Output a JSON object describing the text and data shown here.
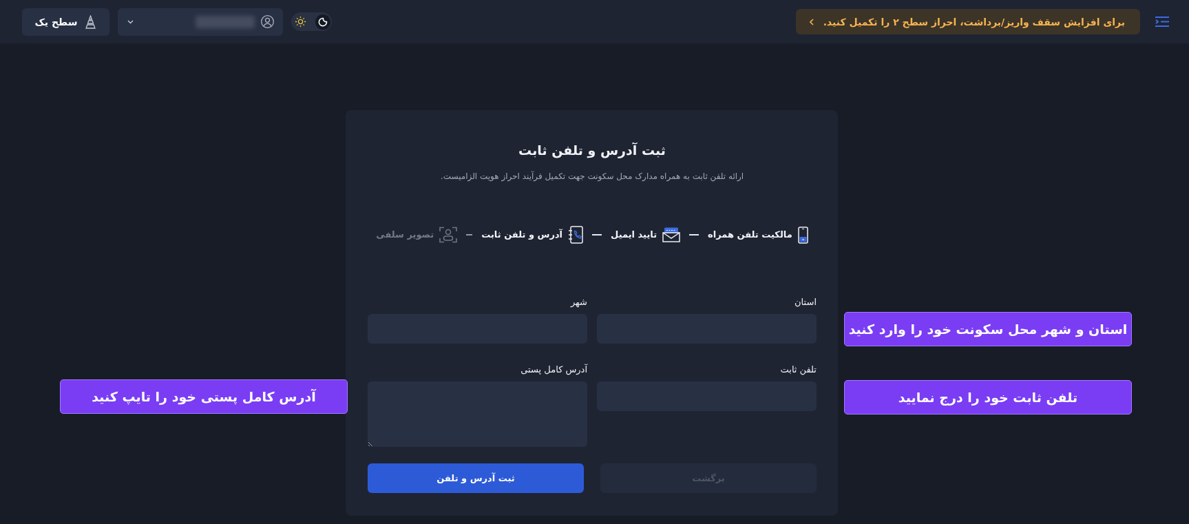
{
  "header": {
    "notice": {
      "text": "برای افزایش سقف واریز/برداشت، احراز سطح ۲ را تکمیل کنید."
    },
    "theme_toggle": {
      "options": [
        {
          "kind": "light",
          "selected": false
        },
        {
          "kind": "dark",
          "selected": true
        }
      ]
    },
    "level_button": {
      "label": "سطح یک"
    }
  },
  "card": {
    "title": "ثبت آدرس و تلفن ثابت",
    "subtitle": "ارائه تلفن ثابت به همراه مدارک محل سکونت جهت تکمیل فرآیند احراز هویت الزامیست.",
    "steps": [
      {
        "kind": "mobile",
        "label": "مالکیت تلفن همراه",
        "disabled": false
      },
      {
        "kind": "email",
        "label": "تایید ایمیل",
        "disabled": false
      },
      {
        "kind": "address",
        "label": "آدرس و تلفن ثابت",
        "disabled": false
      },
      {
        "kind": "selfie",
        "label": "تصویر سلفی",
        "disabled": true
      }
    ],
    "fields": [
      {
        "kind": "input",
        "label": "استان"
      },
      {
        "kind": "input",
        "label": "شهر"
      },
      {
        "kind": "input",
        "label": "تلفن ثابت"
      },
      {
        "kind": "textarea",
        "label": "آدرس کامل پستی"
      }
    ],
    "buttons": [
      {
        "kind": "secondary",
        "label": "برگشت",
        "disabled": true
      },
      {
        "kind": "primary",
        "label": "ثبت آدرس و تلفن",
        "disabled": false
      }
    ]
  },
  "annotations": {
    "right": [
      {
        "text": "استان و شهر محل سکونت خود را وارد کنید"
      },
      {
        "text": "تلفن ثابت خود را درج نمایید"
      }
    ],
    "left": [
      {
        "text": "آدرس کامل پستی خود را تایپ کنید"
      }
    ]
  }
}
